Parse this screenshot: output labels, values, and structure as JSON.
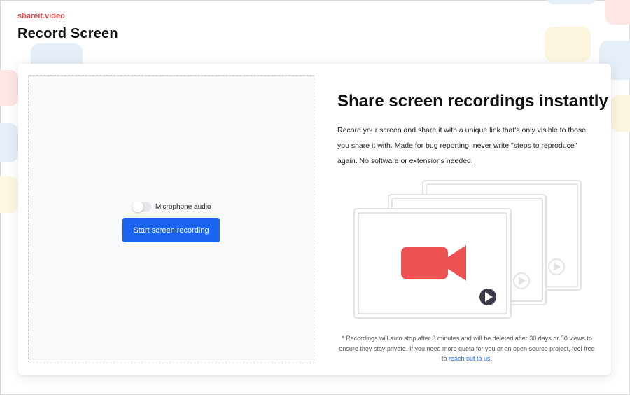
{
  "brand": "shareit.video",
  "page_title": "Record Screen",
  "recorder": {
    "mic_label": "Microphone audio",
    "mic_enabled": false,
    "start_button_label": "Start screen recording"
  },
  "info": {
    "headline": "Share screen recordings instantly",
    "description": "Record your screen and share it with a unique link that's only visible to those you share it with. Made for bug reporting, never write \"steps to reproduce\" again. No software or extensions needed.",
    "footnote_text": "* Recordings will auto stop after 3 minutes and will be deleted after 30 days or 50 views to ensure they stay private. If you need more quota for you or an open source project, feel free to ",
    "footnote_link": "reach out to us",
    "footnote_end": "!"
  },
  "colors": {
    "brand": "#e24c4c",
    "primary": "#1a64f0",
    "camera": "#ee5253",
    "play": "#3a3a4a"
  }
}
